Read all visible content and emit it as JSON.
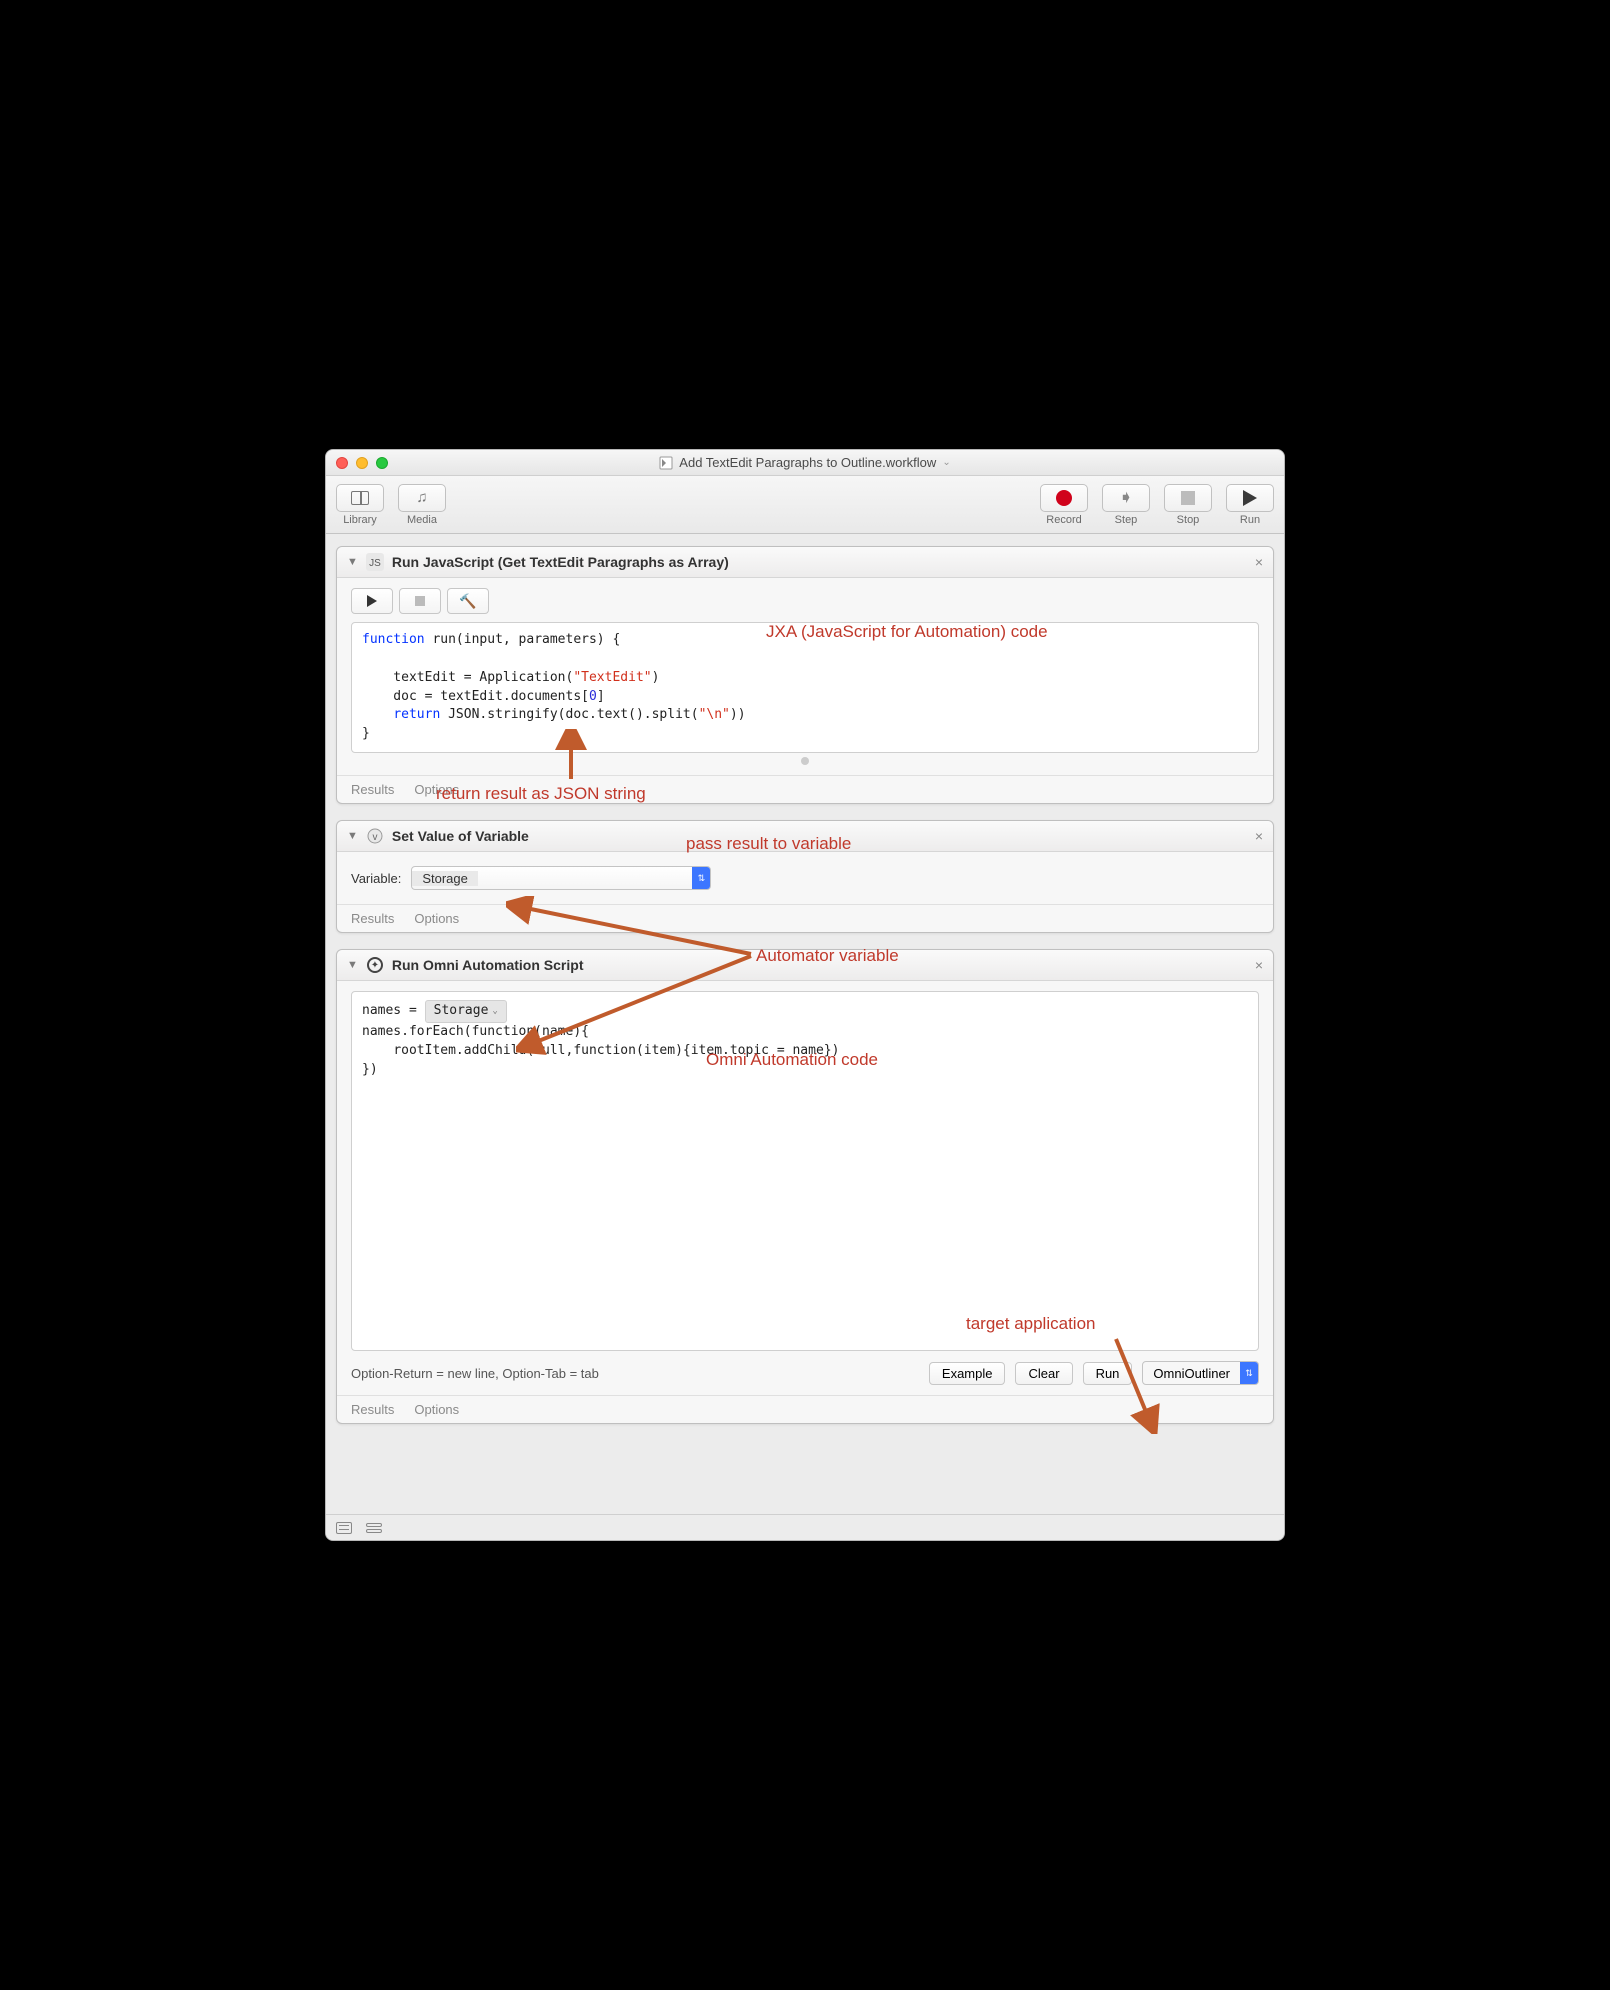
{
  "window": {
    "title": "Add TextEdit Paragraphs to Outline.workflow"
  },
  "toolbar": {
    "library": "Library",
    "media": "Media",
    "record": "Record",
    "step": "Step",
    "stop": "Stop",
    "run": "Run"
  },
  "action1": {
    "title": "Run JavaScript (Get TextEdit Paragraphs as Array)",
    "code_lines": {
      "l1a": "function",
      "l1b": " run(input, parameters) {",
      "l2": "",
      "l3a": "    textEdit = Application(",
      "l3b": "\"TextEdit\"",
      "l3c": ")",
      "l4a": "    doc = textEdit.documents[",
      "l4b": "0",
      "l4c": "]",
      "l5a": "    ",
      "l5b": "return",
      "l5c": " JSON.stringify(doc.text().split(",
      "l5d": "\"\\n\"",
      "l5e": "))",
      "l6": "}"
    },
    "results": "Results",
    "options": "Options"
  },
  "action2": {
    "title": "Set Value of Variable",
    "var_label": "Variable:",
    "var_value": "Storage",
    "results": "Results",
    "options": "Options"
  },
  "action3": {
    "title": "Run Omni Automation Script",
    "code": {
      "p1": "names = ",
      "chip": "Storage",
      "p2": "names.forEach(function(name){",
      "p3": "    rootItem.addChild(null,function(item){item.topic = name})",
      "p4": "})"
    },
    "hint": "Option-Return = new line, Option-Tab = tab",
    "btn_example": "Example",
    "btn_clear": "Clear",
    "btn_run": "Run",
    "app": "OmniOutliner",
    "results": "Results",
    "options": "Options"
  },
  "annotations": {
    "jxa": "JXA (JavaScript for Automation) code",
    "json": "return result as JSON string",
    "pass": "pass result to variable",
    "autovar": "Automator variable",
    "omnicode": "Omni Automation code",
    "target": "target application"
  }
}
